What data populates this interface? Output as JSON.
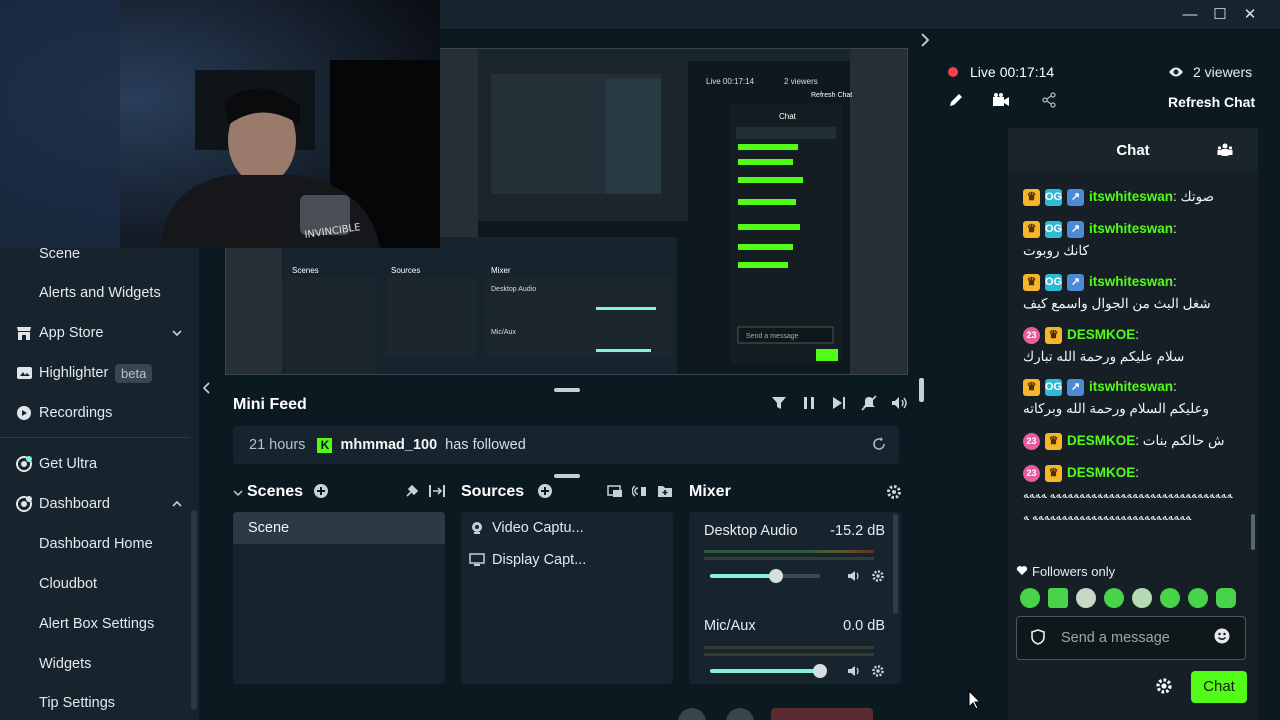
{
  "window": {
    "minimize": "—",
    "maximize": "☐",
    "close": "✕"
  },
  "sidebar": {
    "items": [
      {
        "label": "Scene",
        "icon": "none"
      },
      {
        "label": "Alerts and Widgets",
        "icon": "none"
      },
      {
        "label": "App Store",
        "icon": "store-icon",
        "chevron": "⌄"
      },
      {
        "label": "Highlighter",
        "icon": "highlighter-icon",
        "badge": "beta"
      },
      {
        "label": "Recordings",
        "icon": "play-circle-icon"
      },
      {
        "label": "Get Ultra",
        "icon": "ultra-icon"
      },
      {
        "label": "Dashboard",
        "icon": "dashboard-icon",
        "chevron": "⌃"
      },
      {
        "label": "Dashboard Home",
        "icon": "none"
      },
      {
        "label": "Cloudbot",
        "icon": "none"
      },
      {
        "label": "Alert Box Settings",
        "icon": "none"
      },
      {
        "label": "Widgets",
        "icon": "none"
      },
      {
        "label": "Tip Settings",
        "icon": "none"
      }
    ]
  },
  "minifeed": {
    "title": "Mini Feed",
    "event": {
      "time": "21 hours",
      "platform_badge": "K",
      "user": "mhmmad_100",
      "action": "has followed"
    }
  },
  "scenes": {
    "title": "Scenes",
    "items": [
      "Scene"
    ]
  },
  "sources": {
    "title": "Sources",
    "items": [
      "Video Captu...",
      "Display Capt..."
    ]
  },
  "mixer": {
    "title": "Mixer",
    "channels": [
      {
        "name": "Desktop Audio",
        "db": "-15.2 dB",
        "level": 0.6
      },
      {
        "name": "Mic/Aux",
        "db": "0.0 dB",
        "level": 1.0
      }
    ]
  },
  "stream": {
    "status": "Live",
    "duration": "00:17:14",
    "viewers": "2 viewers",
    "refresh_chat": "Refresh Chat"
  },
  "chat": {
    "title": "Chat",
    "messages": [
      {
        "user": "itswhiteswan",
        "badges": [
          "crown",
          "og",
          "vip"
        ],
        "text": "صوتك"
      },
      {
        "user": "itswhiteswan",
        "badges": [
          "crown",
          "og",
          "vip"
        ],
        "text": "كانك روبوت"
      },
      {
        "user": "itswhiteswan",
        "badges": [
          "crown",
          "og",
          "vip"
        ],
        "text": "شغل البث من الجوال واسمع كيف"
      },
      {
        "user": "DESMKOE",
        "badges": [
          "sub",
          "crown"
        ],
        "text": "سلام عليكم ورحمة الله تبارك"
      },
      {
        "user": "itswhiteswan",
        "badges": [
          "crown",
          "og",
          "vip"
        ],
        "text": "وعليكم السلام ورحمة الله وبركاته"
      },
      {
        "user": "DESMKOE",
        "badges": [
          "sub",
          "crown"
        ],
        "text": "ش حالكم بنات"
      },
      {
        "user": "DESMKOE",
        "badges": [
          "sub",
          "crown"
        ],
        "text": "ﻪﻪﻪﻪﻪﻪﻪﻪﻪﻪﻪﻪﻪﻪﻪﻪﻪﻪﻪﻪﻪﻪﻪﻪﻪﻪﻪﻪﻪﻪﻪ ﻪﻪﻪﻪﻪﻪﻪﻪﻪﻪﻪﻪﻪﻪﻪﻪﻪﻪﻪﻪﻪﻪﻪﻪﻪﻪﻪﻪﻪﻪﻪ ﻪ"
      }
    ],
    "followers_only": "Followers only",
    "input_placeholder": "Send a message",
    "send_label": "Chat"
  },
  "colors": {
    "accent": "#53fc18",
    "live": "#f0424b",
    "slider": "#80f5d2"
  }
}
